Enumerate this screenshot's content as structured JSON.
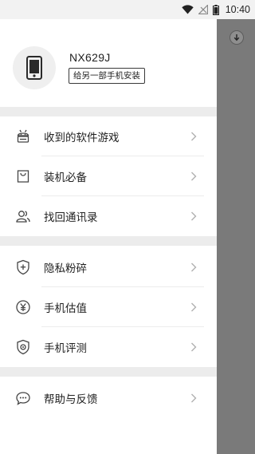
{
  "status_bar": {
    "time": "10:40"
  },
  "profile": {
    "device_name": "NX629J",
    "install_button_label": "给另一部手机安装"
  },
  "menu": {
    "items": [
      {
        "label": "收到的软件游戏",
        "icon": "android-robot-icon"
      },
      {
        "label": "装机必备",
        "icon": "shopping-bag-icon"
      },
      {
        "label": "找回通讯录",
        "icon": "contacts-icon"
      },
      {
        "label": "隐私粉碎",
        "icon": "shield-plus-icon"
      },
      {
        "label": "手机估值",
        "icon": "yen-coin-icon"
      },
      {
        "label": "手机评测",
        "icon": "shield-check-icon"
      },
      {
        "label": "帮助与反馈",
        "icon": "chat-bubble-icon"
      }
    ]
  },
  "colors": {
    "scrim": "#7a7a7a",
    "section_gap": "#ececec",
    "icon": "#444444",
    "chevron": "#b0b0b0"
  }
}
